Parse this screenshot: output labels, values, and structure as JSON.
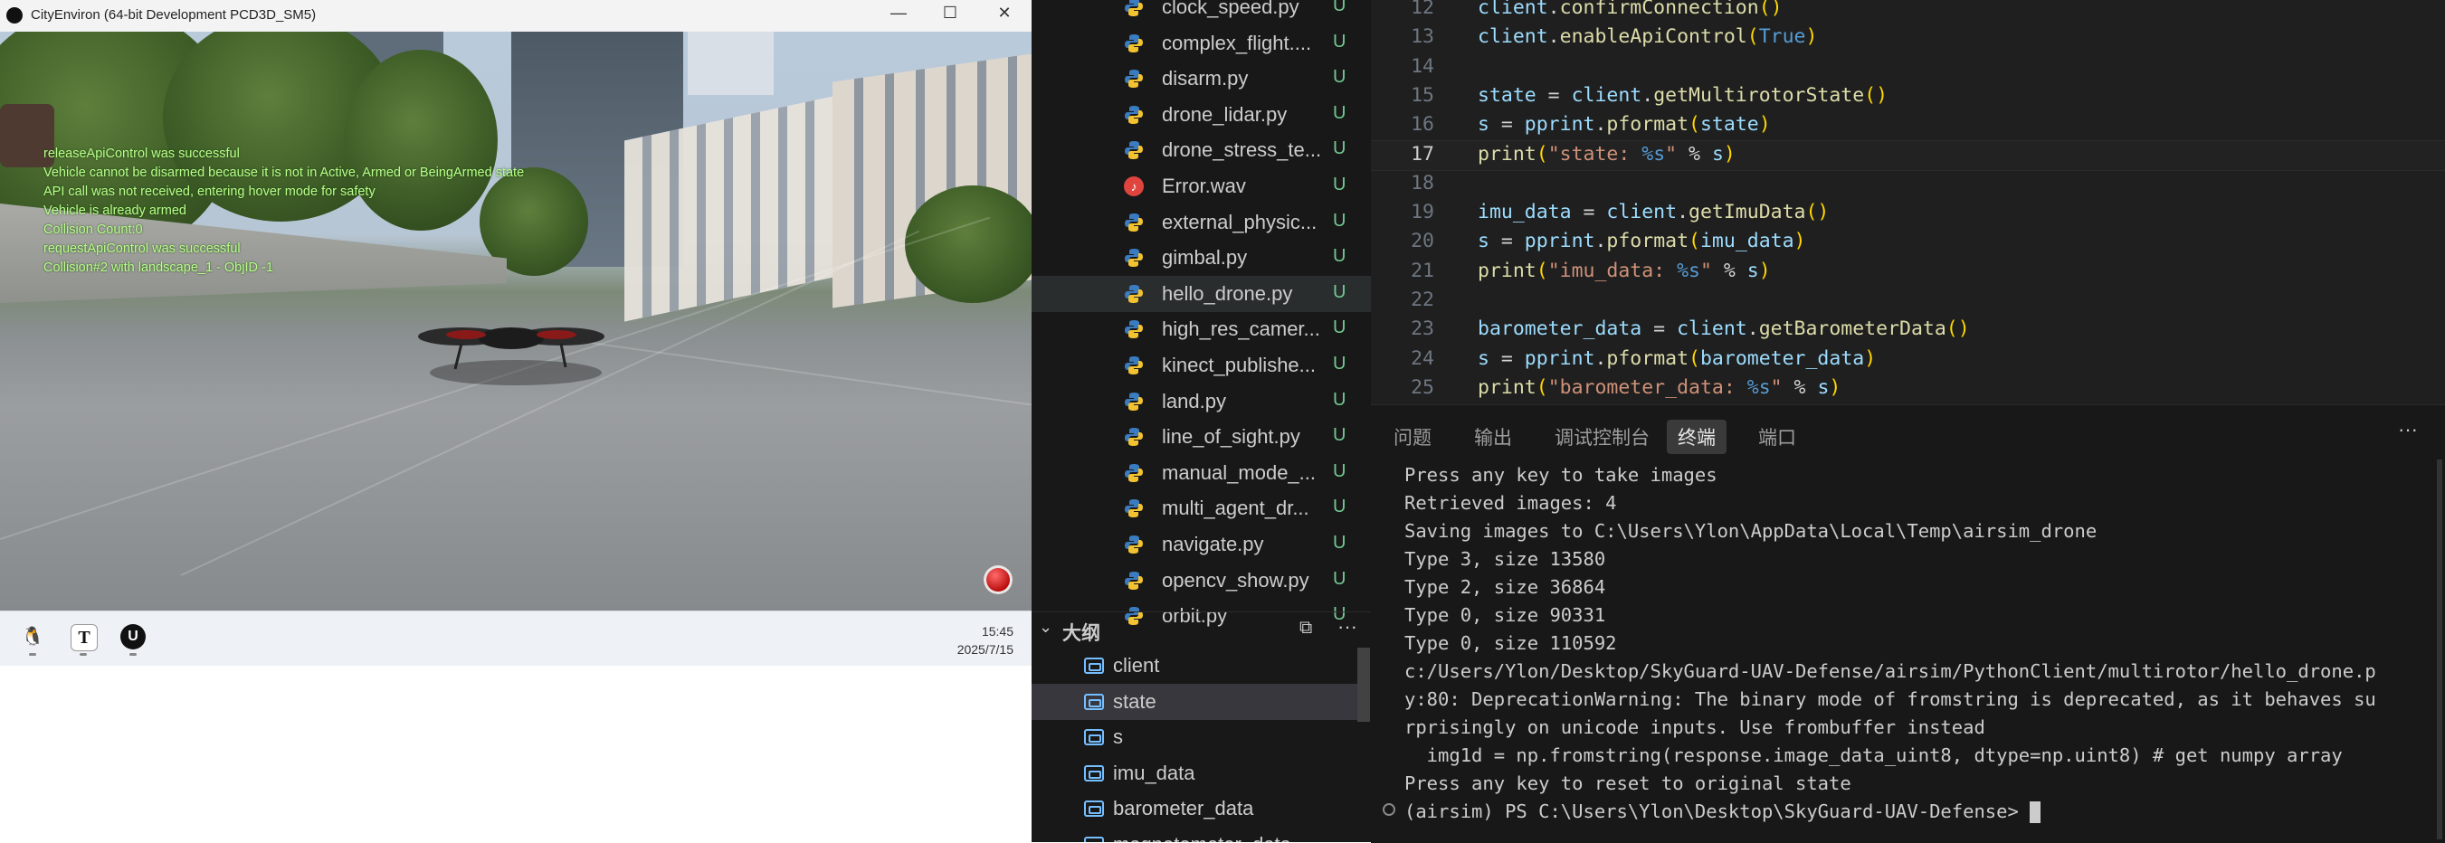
{
  "ue_window": {
    "title": "CityEnviron (64-bit Development PCD3D_SM5)",
    "controls": {
      "minimize": "—",
      "maximize": "☐",
      "close": "✕"
    },
    "log_lines": [
      "releaseApiControl was successful",
      "Vehicle cannot be disarmed because it is not in Active, Armed or BeingArmed state",
      "API call was not received, entering hover mode for safety",
      "Vehicle is already armed",
      "Collision Count:0",
      "requestApiControl was successful",
      "Collision#2 with landscape_1 - ObjID -1"
    ],
    "taskbar": {
      "icons": [
        "qq-penguin-icon",
        "text-editor-icon",
        "unreal-engine-icon"
      ],
      "time": "15:45",
      "date": "2025/7/15"
    }
  },
  "explorer": {
    "files": [
      {
        "name": "clock_speed.py",
        "badge": "U",
        "type": "py"
      },
      {
        "name": "complex_flight....",
        "badge": "U",
        "type": "py"
      },
      {
        "name": "disarm.py",
        "badge": "U",
        "type": "py"
      },
      {
        "name": "drone_lidar.py",
        "badge": "U",
        "type": "py"
      },
      {
        "name": "drone_stress_te...",
        "badge": "U",
        "type": "py"
      },
      {
        "name": "Error.wav",
        "badge": "U",
        "type": "wav"
      },
      {
        "name": "external_physic...",
        "badge": "U",
        "type": "py"
      },
      {
        "name": "gimbal.py",
        "badge": "U",
        "type": "py"
      },
      {
        "name": "hello_drone.py",
        "badge": "U",
        "type": "py",
        "active": true
      },
      {
        "name": "high_res_camer...",
        "badge": "U",
        "type": "py"
      },
      {
        "name": "kinect_publishe...",
        "badge": "U",
        "type": "py"
      },
      {
        "name": "land.py",
        "badge": "U",
        "type": "py"
      },
      {
        "name": "line_of_sight.py",
        "badge": "U",
        "type": "py"
      },
      {
        "name": "manual_mode_...",
        "badge": "U",
        "type": "py"
      },
      {
        "name": "multi_agent_dr...",
        "badge": "U",
        "type": "py"
      },
      {
        "name": "navigate.py",
        "badge": "U",
        "type": "py"
      },
      {
        "name": "opencv_show.py",
        "badge": "U",
        "type": "py"
      },
      {
        "name": "orbit.py",
        "badge": "U",
        "type": "py"
      }
    ],
    "outline_title": "大纲",
    "outline_items": [
      "client",
      "state",
      "s",
      "imu_data",
      "barometer_data",
      "magnetometer_data"
    ]
  },
  "editor": {
    "current_line": 17,
    "lines": [
      {
        "num": "12",
        "html": "<span class='v'>client</span>.<span class='f'>confirmConnection</span><span class='p1'>()</span>"
      },
      {
        "num": "13",
        "html": "<span class='v'>client</span>.<span class='f'>enableApiControl</span><span class='p1'>(</span><span class='k'>True</span><span class='p1'>)</span>"
      },
      {
        "num": "14",
        "html": ""
      },
      {
        "num": "15",
        "html": "<span class='v'>state</span> = <span class='v'>client</span>.<span class='f'>getMultirotorState</span><span class='p1'>()</span>"
      },
      {
        "num": "16",
        "html": "<span class='v'>s</span> = <span class='v'>pprint</span>.<span class='f'>pformat</span><span class='p1'>(</span><span class='v'>state</span><span class='p1'>)</span>"
      },
      {
        "num": "17",
        "html": "<span class='f'>print</span><span class='p1'>(</span><span class='s'>\"state: </span><span class='k'>%s</span><span class='s'>\"</span> % <span class='v'>s</span><span class='p1'>)</span>"
      },
      {
        "num": "18",
        "html": ""
      },
      {
        "num": "19",
        "html": "<span class='v'>imu_data</span> = <span class='v'>client</span>.<span class='f'>getImuData</span><span class='p1'>()</span>"
      },
      {
        "num": "20",
        "html": "<span class='v'>s</span> = <span class='v'>pprint</span>.<span class='f'>pformat</span><span class='p1'>(</span><span class='v'>imu_data</span><span class='p1'>)</span>"
      },
      {
        "num": "21",
        "html": "<span class='f'>print</span><span class='p1'>(</span><span class='s'>\"imu_data: </span><span class='k'>%s</span><span class='s'>\"</span> % <span class='v'>s</span><span class='p1'>)</span>"
      },
      {
        "num": "22",
        "html": ""
      },
      {
        "num": "23",
        "html": "<span class='v'>barometer_data</span> = <span class='v'>client</span>.<span class='f'>getBarometerData</span><span class='p1'>()</span>"
      },
      {
        "num": "24",
        "html": "<span class='v'>s</span> = <span class='v'>pprint</span>.<span class='f'>pformat</span><span class='p1'>(</span><span class='v'>barometer_data</span><span class='p1'>)</span>"
      },
      {
        "num": "25",
        "html": "<span class='f'>print</span><span class='p1'>(</span><span class='s'>\"barometer_data: </span><span class='k'>%s</span><span class='s'>\"</span> % <span class='v'>s</span><span class='p1'>)</span>"
      }
    ]
  },
  "panel": {
    "tabs": [
      {
        "label": "问题"
      },
      {
        "label": "输出"
      },
      {
        "label": "调试控制台"
      },
      {
        "label": "终端",
        "active": true
      },
      {
        "label": "端口"
      }
    ],
    "more": "···",
    "terminal_lines": [
      "Press any key to take images",
      "Retrieved images: 4",
      "Saving images to C:\\Users\\Ylon\\AppData\\Local\\Temp\\airsim_drone",
      "Type 3, size 13580",
      "Type 2, size 36864",
      "Type 0, size 90331",
      "Type 0, size 110592",
      "c:/Users/Ylon/Desktop/SkyGuard-UAV-Defense/airsim/PythonClient/multirotor/hello_drone.p",
      "y:80: DeprecationWarning: The binary mode of fromstring is deprecated, as it behaves su",
      "rprisingly on unicode inputs. Use frombuffer instead",
      "  img1d = np.fromstring(response.image_data_uint8, dtype=np.uint8) # get numpy array",
      "Press any key to reset to original state"
    ],
    "prompt": "(airsim) PS C:\\Users\\Ylon\\Desktop\\SkyGuard-UAV-Defense> "
  }
}
